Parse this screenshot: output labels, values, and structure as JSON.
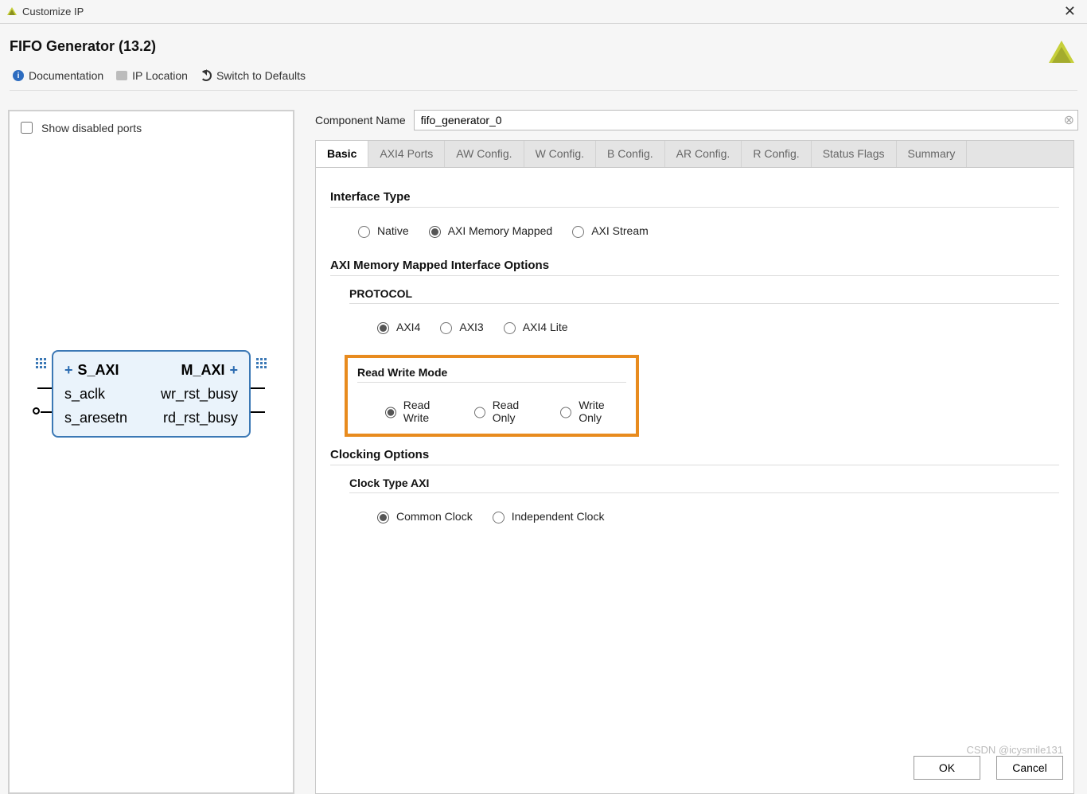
{
  "titlebar": {
    "title": "Customize IP"
  },
  "header": {
    "title": "FIFO Generator (13.2)"
  },
  "toolbar": {
    "documentation": "Documentation",
    "ip_location": "IP Location",
    "switch_defaults": "Switch to Defaults"
  },
  "preview": {
    "show_disabled_label": "Show disabled ports",
    "ports": {
      "s_axi": "S_AXI",
      "m_axi": "M_AXI",
      "s_aclk": "s_aclk",
      "wr_rst_busy": "wr_rst_busy",
      "s_aresetn": "s_aresetn",
      "rd_rst_busy": "rd_rst_busy"
    }
  },
  "config": {
    "component_name_label": "Component Name",
    "component_name_value": "fifo_generator_0",
    "tabs": [
      "Basic",
      "AXI4 Ports",
      "AW Config.",
      "W Config.",
      "B Config.",
      "AR Config.",
      "R Config.",
      "Status Flags",
      "Summary"
    ],
    "active_tab": "Basic",
    "sections": {
      "interface_type": {
        "title": "Interface Type",
        "options": [
          "Native",
          "AXI Memory Mapped",
          "AXI Stream"
        ],
        "selected": "AXI Memory Mapped"
      },
      "axi_mm_options": {
        "title": "AXI Memory Mapped Interface Options",
        "protocol": {
          "title": "PROTOCOL",
          "options": [
            "AXI4",
            "AXI3",
            "AXI4 Lite"
          ],
          "selected": "AXI4"
        },
        "rw_mode": {
          "title": "Read Write Mode",
          "options": [
            "Read Write",
            "Read Only",
            "Write Only"
          ],
          "selected": "Read Write"
        }
      },
      "clocking": {
        "title": "Clocking Options",
        "clock_type": {
          "title": "Clock Type AXI",
          "options": [
            "Common Clock",
            "Independent Clock"
          ],
          "selected": "Common Clock"
        }
      }
    }
  },
  "footer": {
    "ok": "OK",
    "cancel": "Cancel"
  },
  "watermark": "CSDN @icysmile131"
}
